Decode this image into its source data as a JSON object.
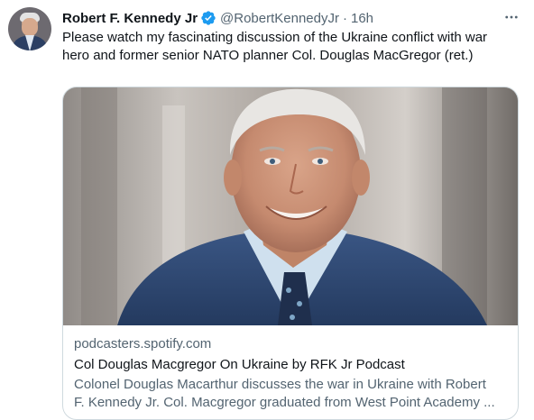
{
  "author": {
    "name": "Robert F. Kennedy Jr",
    "handle": "@RobertKennedyJr",
    "separator": "·",
    "time": "16h"
  },
  "icons": {
    "verified": "verified-badge-icon",
    "more": "more-options-icon"
  },
  "colors": {
    "verified_blue": "#1d9bf0",
    "secondary_text": "#536471",
    "primary_text": "#0f1419",
    "border": "#cfd9de"
  },
  "tweet": {
    "text_line1": "Please watch my fascinating discussion of the Ukraine conflict with war",
    "text_line2": "hero and former senior NATO planner Col. Douglas MacGregor (ret.)"
  },
  "link_card": {
    "domain": "podcasters.spotify.com",
    "title": "Col Douglas Macgregor On Ukraine by RFK Jr Podcast",
    "description_line1": "Colonel Douglas Macarthur discusses the war in Ukraine with Robert",
    "description_line2": "F. Kennedy Jr. Col. Macgregor graduated from West Point Academy ..."
  }
}
